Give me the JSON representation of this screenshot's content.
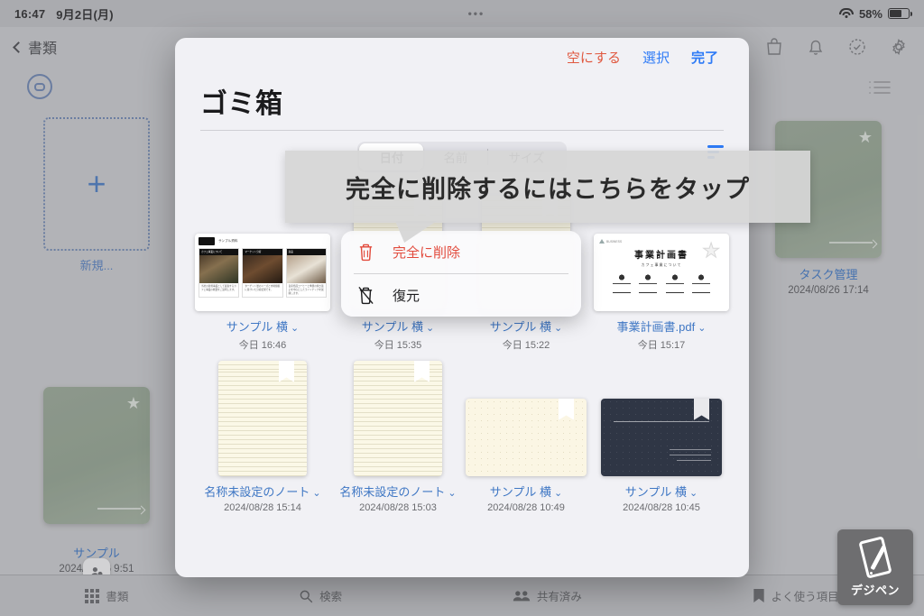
{
  "status_bar": {
    "time": "16:47",
    "date": "9月2日(月)",
    "dots": "•••",
    "battery_percent": "58%",
    "wifi_icon": "wifi-icon",
    "battery_icon": "battery-icon"
  },
  "background_app": {
    "back_label": "書類",
    "title": "",
    "nav_icons": [
      "bag-icon",
      "bell-icon",
      "check-circle-icon",
      "gear-icon"
    ],
    "list_icon": "list-view-icon",
    "scan_icon": "scan-icon",
    "new_doc": {
      "plus": "+",
      "label": "新規..."
    },
    "cards": [
      {
        "name": "サンプル",
        "date": "2024/08/26 9:51",
        "cover": "#93a391",
        "star": "★"
      },
      {
        "name": "タスク管理",
        "date": "2024/08/26 17:14",
        "cover": "#93a391",
        "star": "★"
      }
    ],
    "tabs": [
      {
        "label": "書類",
        "icon": "grid-icon"
      },
      {
        "label": "検索",
        "icon": "search-icon"
      },
      {
        "label": "共有済み",
        "icon": "people-icon"
      },
      {
        "label": "よく使う項目",
        "icon": "bookmark-icon"
      }
    ]
  },
  "sheet": {
    "title": "ゴミ箱",
    "header_buttons": {
      "empty": "空にする",
      "select": "選択",
      "done": "完了"
    },
    "colors": {
      "destructive": "#E0583F",
      "accent": "#2E7BF6",
      "sheet_bg": "#F1F1F5"
    },
    "segmented": {
      "options": [
        "日付",
        "名前",
        "サイズ"
      ],
      "selected": "日付"
    },
    "sort_icon": "sort-order-icon",
    "items": [
      {
        "name": "サンプル 横",
        "date": "今日 16:46",
        "caret": "⌄",
        "thumb": "slide-deck"
      },
      {
        "name": "サンプル 横",
        "date": "今日 15:35",
        "caret": "⌄",
        "thumb": "note-lined"
      },
      {
        "name": "サンプル 横",
        "date": "今日 15:22",
        "caret": "⌄",
        "thumb": "note-lined"
      },
      {
        "name": "事業計画書.pdf",
        "date": "今日 15:17",
        "caret": "⌄",
        "thumb": "pdf-plan"
      },
      {
        "name": "名称未設定のノート",
        "date": "2024/08/28 15:14",
        "caret": "⌄",
        "thumb": "note-lined"
      },
      {
        "name": "名称未設定のノート",
        "date": "2024/08/28 15:03",
        "caret": "⌄",
        "thumb": "note-lined"
      },
      {
        "name": "サンプル 横",
        "date": "2024/08/28 10:49",
        "caret": "⌄",
        "thumb": "note-landscape"
      },
      {
        "name": "サンプル 横",
        "date": "2024/08/28 10:45",
        "caret": "⌄",
        "thumb": "note-dark"
      }
    ],
    "pdf_thumb": {
      "title": "事業計画書",
      "subtitle": "カフェ事業について"
    }
  },
  "context_menu": {
    "items": [
      {
        "label": "完全に削除",
        "icon": "trash-icon",
        "style": "destructive"
      },
      {
        "label": "復元",
        "icon": "trash-slash-icon",
        "style": "normal"
      }
    ]
  },
  "annotation": {
    "text": "完全に削除するにはこちらをタップ"
  },
  "watermark": {
    "label": "デジペン",
    "icon": "tablet-pen-icon"
  }
}
